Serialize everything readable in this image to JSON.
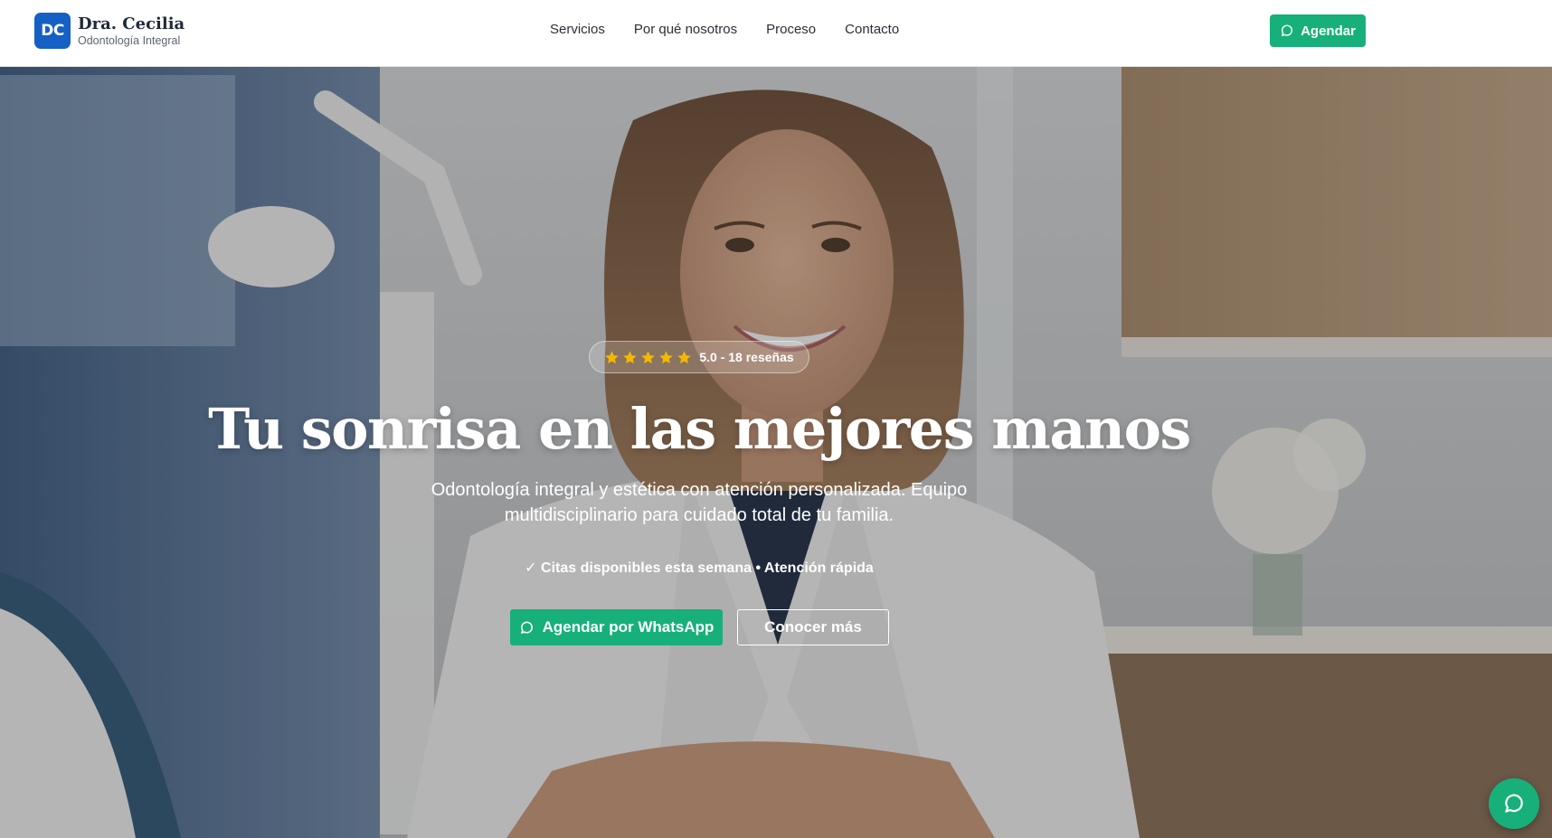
{
  "header": {
    "logo_initials": "DC",
    "brand_name": "Dra. Cecilia",
    "brand_subtitle": "Odontología Integral",
    "nav": [
      "Servicios",
      "Por qué nosotros",
      "Proceso",
      "Contacto"
    ],
    "cta_label": "Agendar",
    "cta_icon": "chat-bubble-icon"
  },
  "hero": {
    "rating": {
      "stars": 5,
      "text": "5.0 - 18 reseñas"
    },
    "title": "Tu sonrisa en las mejores manos",
    "subtitle": "Odontología integral y estética con atención personalizada. Equipo multidisciplinario para cuidado total de tu familia.",
    "note": "✓ Citas disponibles esta semana • Atención rápida",
    "primary_button": "Agendar por WhatsApp",
    "secondary_button": "Conocer más",
    "background": "dentist-portrait-photo"
  },
  "floating_chat": {
    "icon": "chat-bubble-icon"
  },
  "colors": {
    "brand_blue": "#1560c4",
    "accent_green": "#17b07a",
    "star_gold": "#f5b800"
  }
}
